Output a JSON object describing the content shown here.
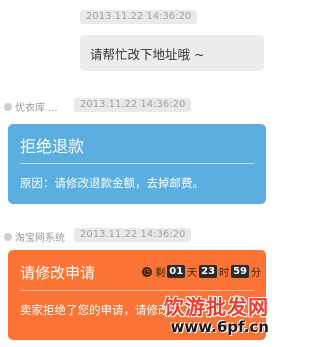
{
  "message1": {
    "timestamp": "2013.11.22  14:36:20",
    "text": "请帮忙改下地址哦 ~"
  },
  "message2": {
    "sender": "优衣库 ...",
    "timestamp": "2013.11.22  14:36:20",
    "card": {
      "title": "拒绝退款",
      "reason": "原因：请修改退款金额，去掉邮费。"
    }
  },
  "message3": {
    "sender": "淘宝网系统",
    "timestamp": "2013.11.22  14:36:20",
    "card": {
      "title": "请修改申请",
      "message": "卖家拒绝了您的申请，请修改",
      "countdown": {
        "prefix": "剩",
        "days": "01",
        "days_unit": "天",
        "hours": "23",
        "hours_unit": "时",
        "minutes": "59",
        "minutes_unit": "分"
      }
    }
  },
  "watermark": {
    "cn": "饮游批发网",
    "url": "www.6pf.cn"
  },
  "colors": {
    "blue_card": "#5aaee0",
    "orange_card": "#fb7436",
    "watermark_red": "#f23a2d"
  }
}
